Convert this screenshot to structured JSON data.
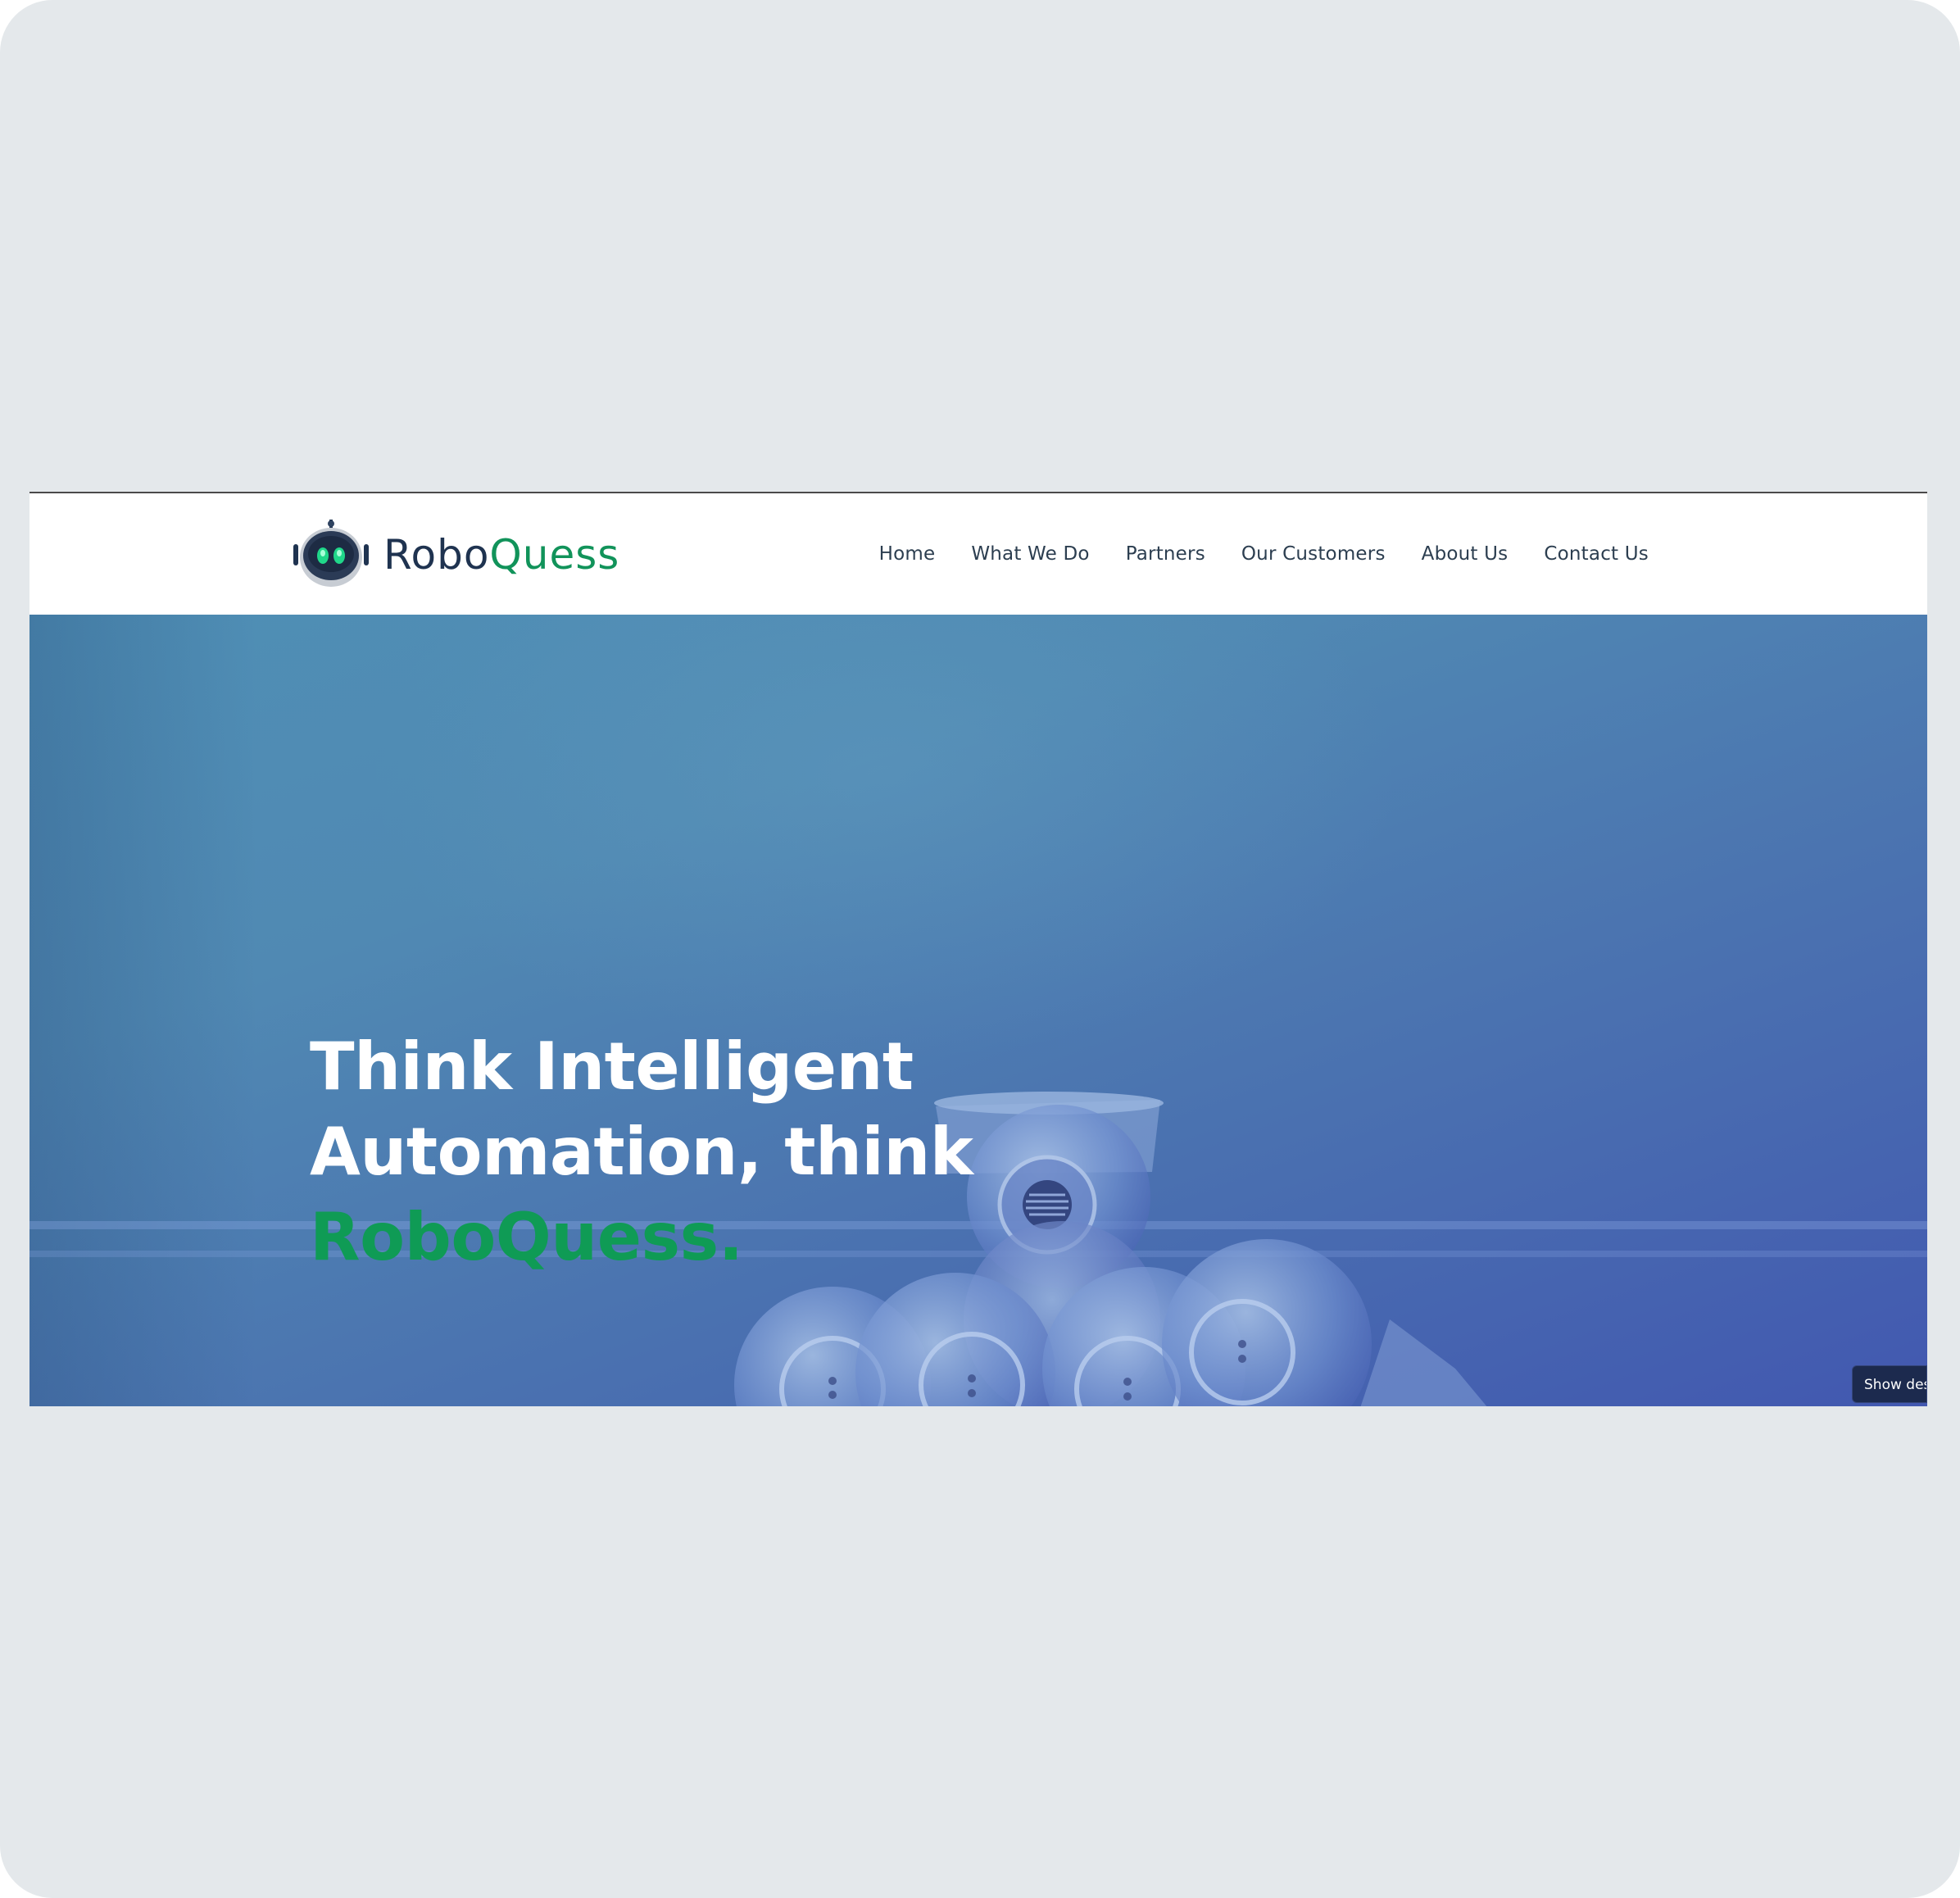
{
  "brand": {
    "name_part1": "Robo",
    "name_part2": "Quess",
    "logo_icon": "robot-head-icon",
    "colors": {
      "dark": "#1f3350",
      "green": "#11935a"
    }
  },
  "nav": {
    "items": [
      {
        "label": "Home"
      },
      {
        "label": "What We Do"
      },
      {
        "label": "Partners"
      },
      {
        "label": "Our Customers"
      },
      {
        "label": "About Us"
      },
      {
        "label": "Contact Us"
      }
    ]
  },
  "hero": {
    "line1": "Think Intelligent",
    "line2": "Automation, think",
    "accent_line": "RoboQuess.",
    "background_image": "robot-arm-image",
    "colors": {
      "accent": "#0f9b55",
      "overlay": "#4a6fb2"
    }
  },
  "desktop_toggle": {
    "label": "Show deskt"
  }
}
